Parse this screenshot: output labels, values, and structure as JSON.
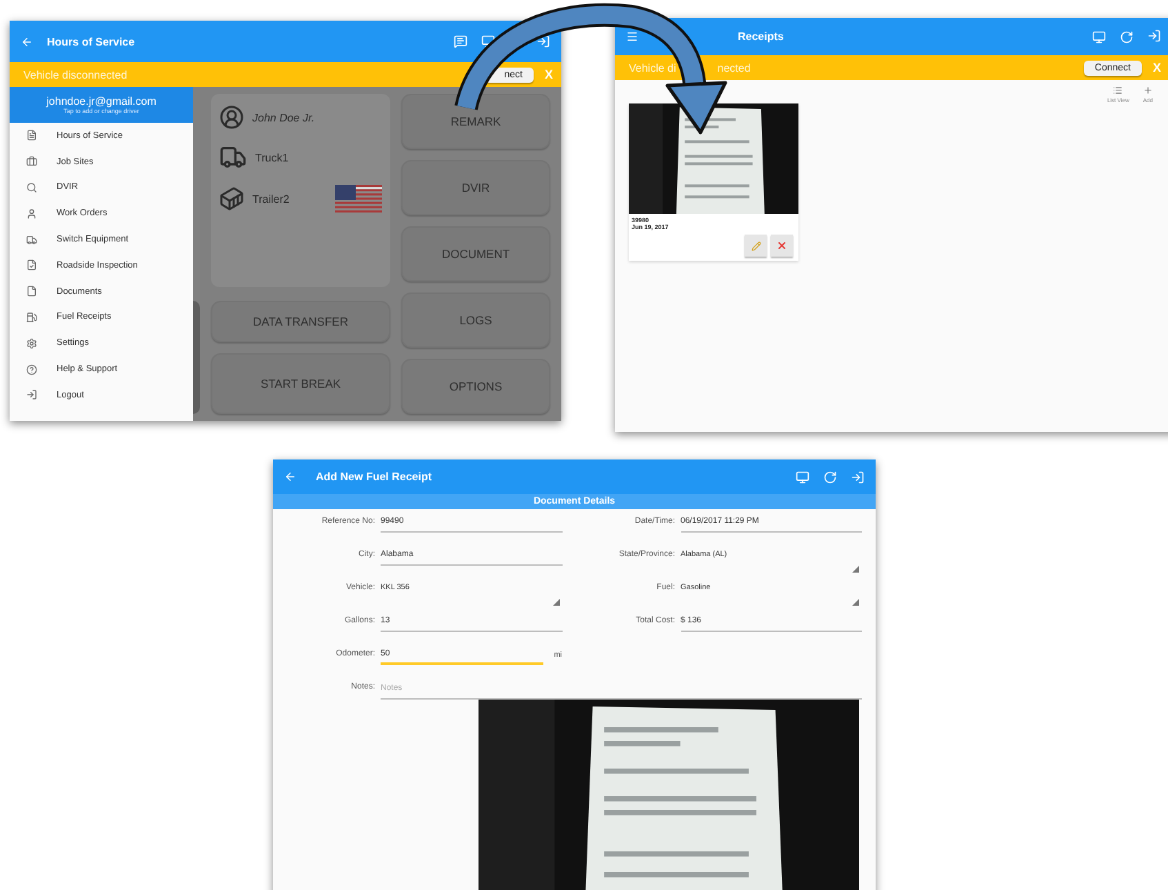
{
  "home_screen": {
    "title": "Hours of Service",
    "banner": {
      "text": "Vehicle disconnected",
      "button": "nect",
      "close": "X"
    },
    "drawer": {
      "email": "johndoe.jr@gmail.com",
      "hint": "Tap to add or change driver",
      "items": [
        {
          "label": "Hours of Service"
        },
        {
          "label": "Job Sites"
        },
        {
          "label": "DVIR"
        },
        {
          "label": "Work Orders"
        },
        {
          "label": "Switch Equipment"
        },
        {
          "label": "Roadside Inspection"
        },
        {
          "label": "Documents"
        },
        {
          "label": "Fuel Receipts"
        },
        {
          "label": "Settings"
        },
        {
          "label": "Help & Support"
        },
        {
          "label": "Logout"
        }
      ]
    },
    "driver": {
      "name": "John Doe Jr.",
      "truck": "Truck1",
      "trailer": "Trailer2"
    },
    "middle_buttons": [
      "DATA TRANSFER",
      "START BREAK"
    ],
    "right_buttons": [
      "REMARK",
      "DVIR",
      "DOCUMENT",
      "LOGS",
      "OPTIONS"
    ]
  },
  "receipts_screen": {
    "title": "Receipts",
    "banner": {
      "text_start": "Vehicle di",
      "text_end": "nected",
      "button": "Connect",
      "close": "X"
    },
    "actions": [
      "List View",
      "Add"
    ],
    "receipts": [
      {
        "kind": "picture",
        "number": "39980",
        "date": "Jun 19, 2017"
      }
    ]
  },
  "add_receipt_screen": {
    "title": "Add New Fuel Receipt",
    "section": "Document Details",
    "fields": [
      {
        "label": "Reference No:",
        "value": "99490",
        "kind": "text",
        "focused": false
      },
      {
        "label": "Date/Time:",
        "value": "06/19/2017 11:29 PM",
        "kind": "text",
        "focused": false
      },
      {
        "label": "City:",
        "value": "Alabama",
        "kind": "text",
        "focused": false
      },
      {
        "label": "State/Province:",
        "value": "Alabama (AL)",
        "kind": "select",
        "focused": false
      },
      {
        "label": "Vehicle:",
        "value": "KKL 356",
        "kind": "select",
        "focused": false
      },
      {
        "label": "Fuel:",
        "value": "Gasoline",
        "kind": "select",
        "focused": false
      },
      {
        "label": "Gallons:",
        "value": "13",
        "kind": "text",
        "focused": false
      },
      {
        "label": "Total Cost:",
        "value": "$ 136",
        "kind": "text",
        "focused": false
      },
      {
        "label": "Odometer:",
        "value": "50",
        "kind": "text",
        "focused": true,
        "unit": "mi"
      }
    ],
    "notes": {
      "label": "Notes:",
      "placeholder": "Notes"
    }
  }
}
